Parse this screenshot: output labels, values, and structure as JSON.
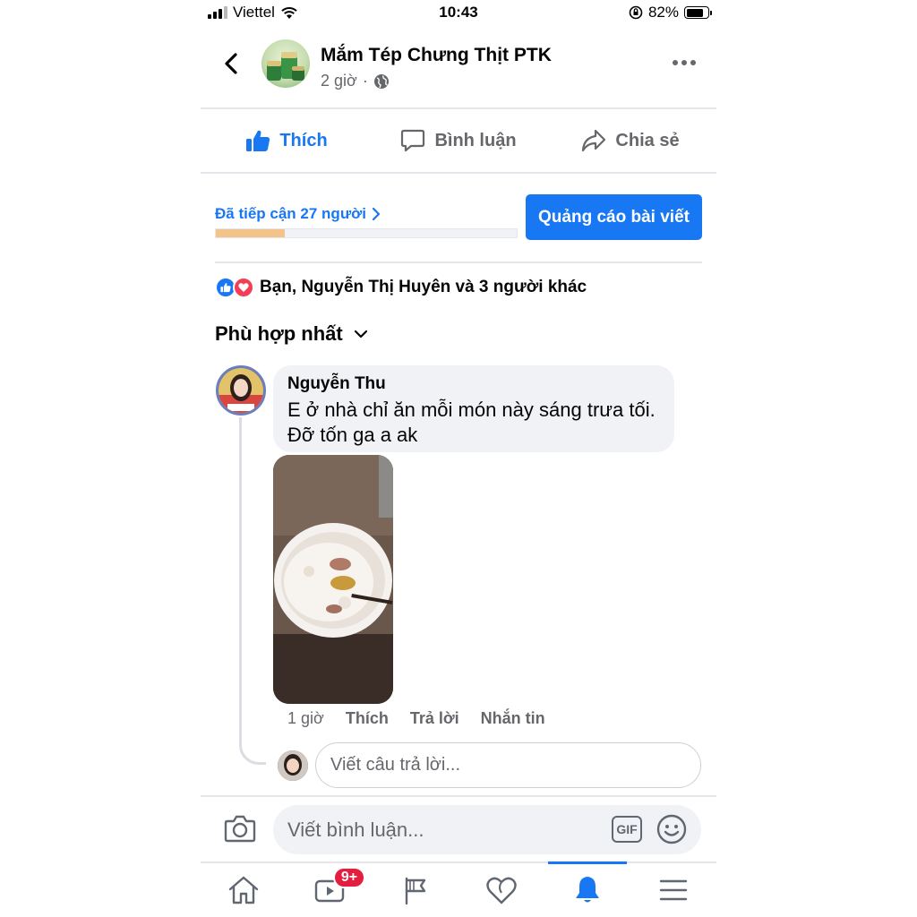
{
  "status_bar": {
    "carrier": "Viettel",
    "time": "10:43",
    "battery_percent": "82%",
    "battery_level": 0.82
  },
  "post_header": {
    "page_name": "Mắm Tép Chưng Thịt PTK",
    "time_ago": "2 giờ",
    "dot": "·",
    "avatar_icon": "page-product-photo",
    "privacy_icon": "globe-icon"
  },
  "actions": {
    "like": "Thích",
    "comment": "Bình luận",
    "share": "Chia sẻ"
  },
  "reach": {
    "label": "Đã tiếp cận 27 người",
    "progress_fraction": 0.23,
    "promote_button": "Quảng cáo bài viết"
  },
  "reactions": {
    "summary": "Bạn, Nguyễn Thị Huyên và 3 người khác",
    "icons": [
      "like-reaction-icon",
      "love-reaction-icon"
    ]
  },
  "sort": {
    "label": "Phù hợp nhất"
  },
  "comment": {
    "author": "Nguyễn Thu",
    "text_line1": "E ở nhà chỉ ăn mỗi món này sáng trưa tối.",
    "text_line2": "Đỡ tốn ga a ak",
    "time_ago": "1 giờ",
    "like": "Thích",
    "reply": "Trả lời",
    "message": "Nhắn tin",
    "reply_placeholder": "Viết câu trả lời..."
  },
  "composer": {
    "placeholder": "Viết bình luận...",
    "gif": "GIF"
  },
  "bottom_nav": {
    "items": [
      "home-icon",
      "watch-icon",
      "pages-flag-icon",
      "dating-heart-icon",
      "notifications-bell-icon",
      "menu-icon"
    ],
    "watch_badge": "9+",
    "active": "notifications-bell-icon"
  },
  "colors": {
    "brand_blue": "#1877f2",
    "secondary_text": "#65676b",
    "reach_fill": "#f3c48a",
    "badge_red": "#e41e3f"
  }
}
